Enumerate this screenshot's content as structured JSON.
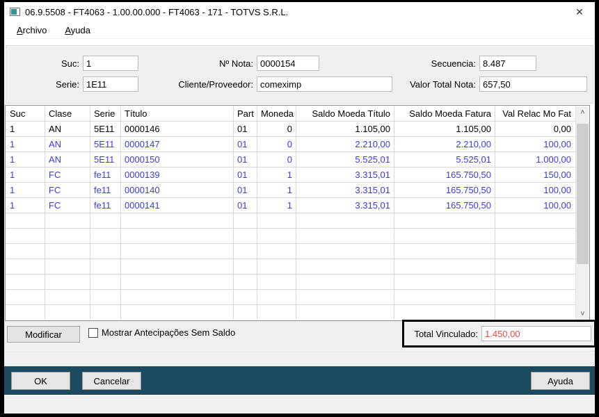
{
  "window": {
    "title": "06.9.5508 - FT4063 - 1.00.00.000 - FT4063 - 171 - TOTVS S.R.L."
  },
  "icons": {
    "close": "✕",
    "scroll_up": "˄",
    "scroll_down": "˅"
  },
  "menu": {
    "items": [
      {
        "label": "Archivo"
      },
      {
        "label": "Ayuda"
      }
    ]
  },
  "form": {
    "fields": [
      {
        "label": "Suc:",
        "value": "1"
      },
      {
        "label": "Nº Nota:",
        "value": "0000154"
      },
      {
        "label": "Secuencia:",
        "value": "8.487"
      },
      {
        "label": "Serie:",
        "value": "1E11"
      },
      {
        "label": "Cliente/Proveedor:",
        "value": "comeximp"
      },
      {
        "label": "Valor Total Nota:",
        "value": "657,50"
      }
    ]
  },
  "table": {
    "columns": [
      "Suc",
      "Clase",
      "Serie",
      "Título",
      "Part",
      "Moneda",
      "Saldo Moeda Título",
      "Saldo Moeda Fatura",
      "Val Relac Mo Fat"
    ],
    "rows": [
      {
        "color": "black",
        "cells": [
          "1",
          "AN",
          "5E11",
          "0000146",
          "01",
          "0",
          "1.105,00",
          "1.105,00",
          "0,00"
        ]
      },
      {
        "color": "blue",
        "cells": [
          "1",
          "AN",
          "5E11",
          "0000147",
          "01",
          "0",
          "2.210,00",
          "2.210,00",
          "100,00"
        ]
      },
      {
        "color": "blue",
        "cells": [
          "1",
          "AN",
          "5E11",
          "0000150",
          "01",
          "0",
          "5.525,01",
          "5.525,01",
          "1.000,00"
        ]
      },
      {
        "color": "blue",
        "cells": [
          "1",
          "FC",
          "fe11",
          "0000139",
          "01",
          "1",
          "3.315,01",
          "165.750,50",
          "150,00"
        ]
      },
      {
        "color": "blue",
        "cells": [
          "1",
          "FC",
          "fe11",
          "0000140",
          "01",
          "1",
          "3.315,01",
          "165.750,50",
          "100,00"
        ]
      },
      {
        "color": "blue",
        "cells": [
          "1",
          "FC",
          "fe11",
          "0000141",
          "01",
          "1",
          "3.315,01",
          "165.750,50",
          "100,00"
        ]
      }
    ],
    "empty_row_count": 7
  },
  "footer": {
    "modify_button": "Modificar",
    "checkbox_label": "Mostrar Antecipações Sem Saldo",
    "checkbox_checked": false,
    "total_label": "Total Vinculado:",
    "total_value": "1.450,00"
  },
  "actions": {
    "ok": "OK",
    "cancel": "Cancelar",
    "help": "Ayuda"
  },
  "colors": {
    "accent_teal": "#1c4a5e",
    "row_blue": "#3a3ae8",
    "total_red": "#f14848"
  }
}
